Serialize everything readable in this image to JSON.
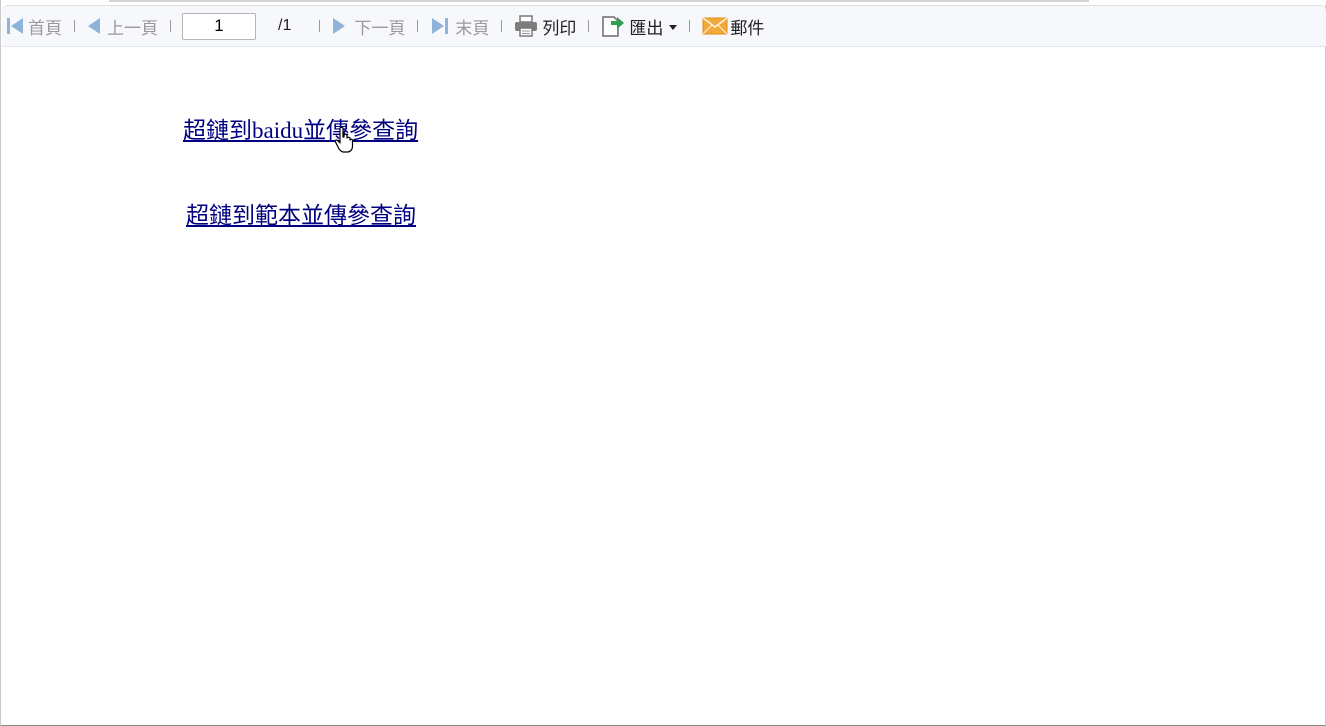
{
  "toolbar": {
    "first_label": "首頁",
    "prev_label": "上一頁",
    "page_value": "1",
    "page_total": "/1",
    "next_label": "下一頁",
    "last_label": "末頁",
    "print_label": "列印",
    "export_label": "匯出",
    "mail_label": "郵件",
    "icons": {
      "first": "first-page-icon",
      "prev": "prev-page-icon",
      "next": "next-page-icon",
      "last": "last-page-icon",
      "print": "printer-icon",
      "export": "export-icon",
      "mail": "envelope-icon"
    },
    "colors": {
      "nav_icon": "#8fb3d9",
      "disabled_text": "#9a9a9a",
      "enabled_text": "#222222",
      "export_arrow": "#2e9e4f",
      "mail_icon": "#f2a93b"
    }
  },
  "content": {
    "links": [
      {
        "label": "超鏈到baidu並傳參查詢"
      },
      {
        "label": "超鏈到範本並傳參查詢"
      }
    ],
    "link_color": "#000080"
  }
}
